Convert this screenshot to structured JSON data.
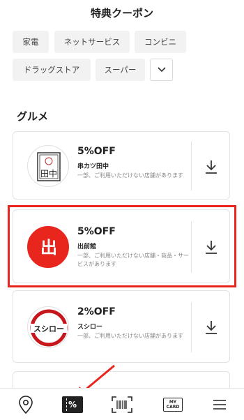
{
  "header": {
    "title": "特典クーポン"
  },
  "filters": [
    "家電",
    "ネットサービス",
    "コンビニ",
    "ドラッグストア",
    "スーパー"
  ],
  "filter_more_icon": "chevron-down-icon",
  "section": {
    "title": "グルメ"
  },
  "coupons": [
    {
      "discount": "5%OFF",
      "name": "串カツ田中",
      "note": "一部、ご利用いただけない店舗があります",
      "logo_icon": "kushikatsu-tanaka-logo"
    },
    {
      "discount": "5%OFF",
      "name": "出前館",
      "note": "一部、ご利用いただけない店舗・商品・サービスがあります",
      "logo_icon": "demaecan-logo",
      "logo_text": "出",
      "logo_color": "#e8261e"
    },
    {
      "discount": "2%OFF",
      "name": "スシロー",
      "note": "一部、ご利用いただけない店舗があります",
      "logo_icon": "sushiro-logo",
      "logo_text": "スシロー",
      "logo_color": "#c8161d"
    }
  ],
  "tabbar": {
    "coupon_label": "%",
    "mycard_line1": "MY",
    "mycard_line2": "CARD"
  },
  "colors": {
    "accent": "#e8261e"
  }
}
